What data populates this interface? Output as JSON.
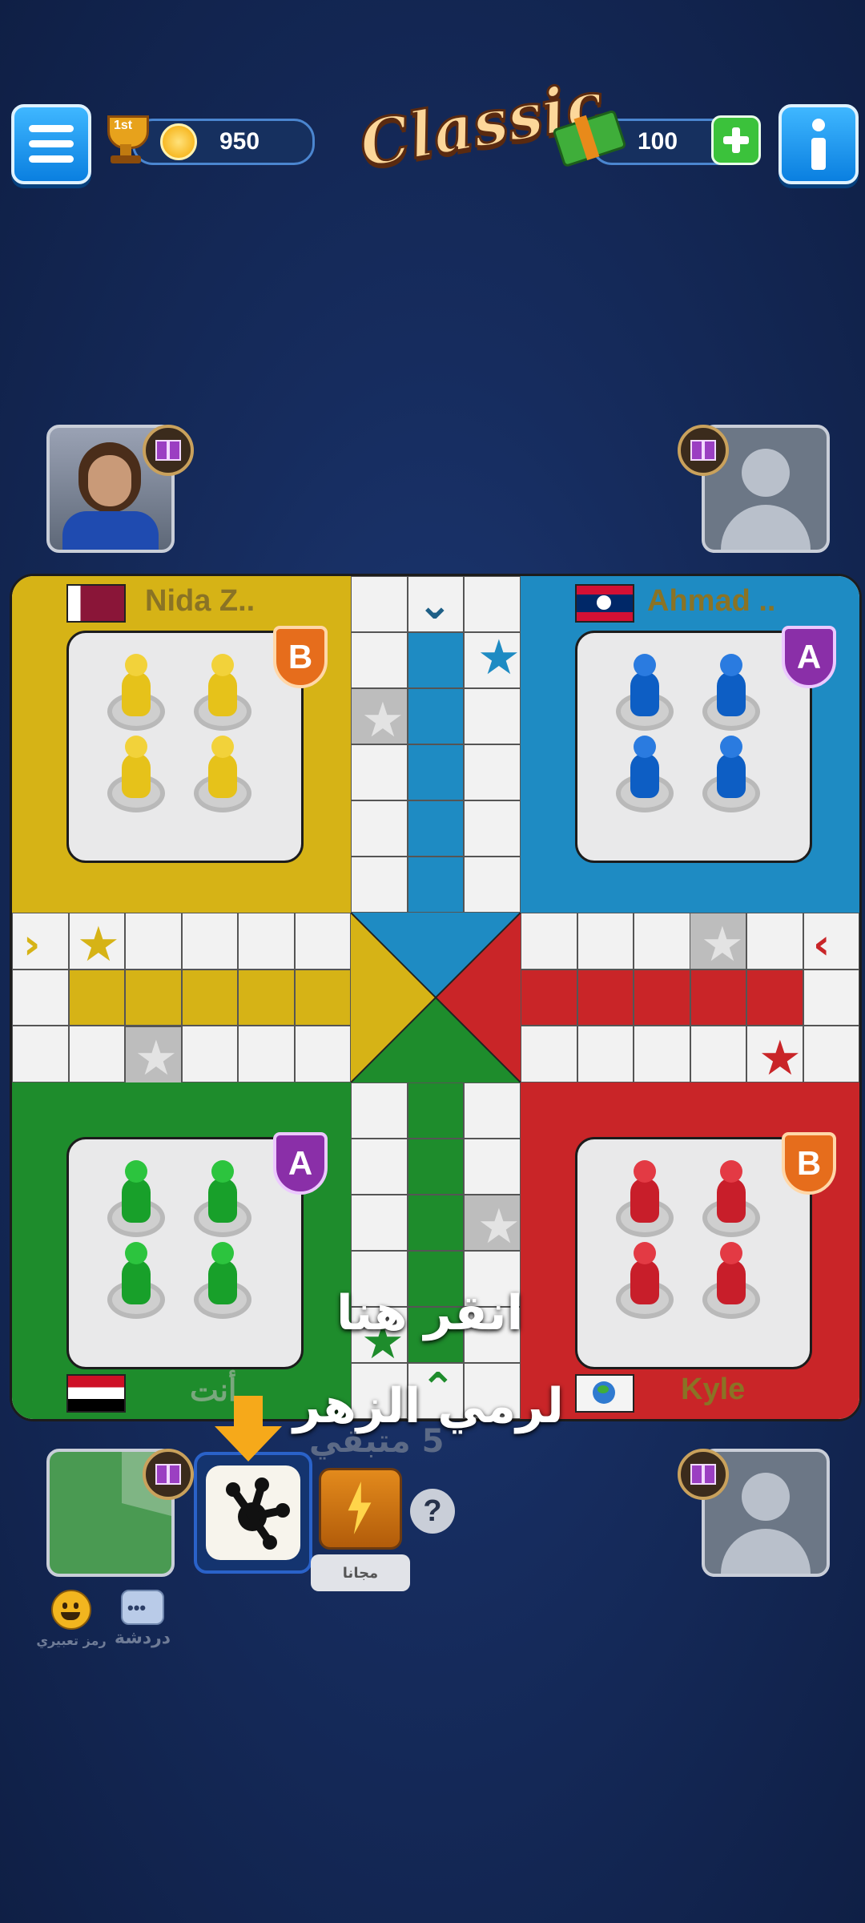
{
  "top_bar": {
    "coins": "950",
    "rank_label": "1st",
    "logo": "Classic",
    "cash": "100"
  },
  "players": {
    "top_left": {
      "name": "Nida Z..",
      "flag": "Qatar",
      "badge": "B"
    },
    "top_right": {
      "name": "Ahmad ..",
      "flag": "Laos",
      "badge": "A"
    },
    "bottom_left": {
      "name": "أنت",
      "flag": "Egypt",
      "badge": "A"
    },
    "bottom_right": {
      "name": "Kyle",
      "flag": "World",
      "badge": "B"
    }
  },
  "board_colors": {
    "yellow": "#d6b316",
    "blue": "#1e8bc3",
    "green": "#1e8c2c",
    "red": "#c92528"
  },
  "tutorial": {
    "line1": "انقر هنا",
    "line2": "لرمي الزهر"
  },
  "controls": {
    "free_label": "مجانا",
    "remaining": "5 متبقي",
    "help": "?",
    "emoji_label": "رمز تعبيري",
    "chat_label": "دردشة"
  }
}
